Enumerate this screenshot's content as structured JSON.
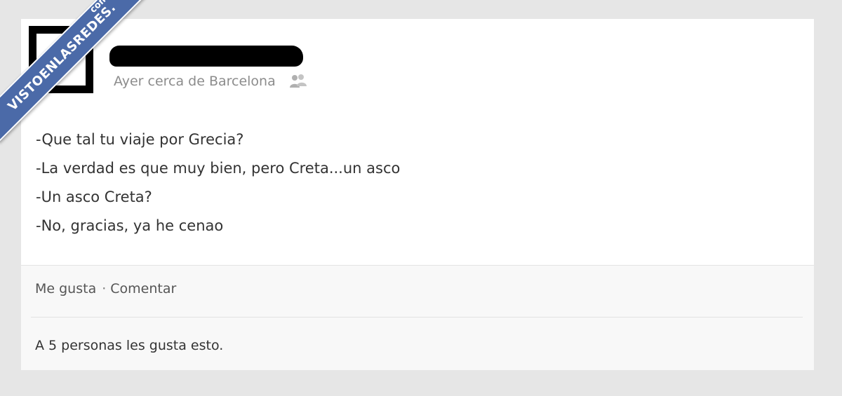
{
  "watermark": {
    "text": "VISTOENLASREDES.",
    "suffix": "com",
    "color": "#4b6aa8"
  },
  "post": {
    "meta": {
      "time_location": "Ayer cerca de Barcelona",
      "audience_icon": "people-icon"
    },
    "body_lines": [
      "-Que tal tu viaje por Grecia?",
      "-La verdad es que muy bien, pero Creta...un asco",
      "-Un asco Creta?",
      "-No, gracias, ya he cenao"
    ],
    "actions": {
      "like_label": "Me gusta",
      "separator": "·",
      "comment_label": "Comentar"
    },
    "likes_summary": "A 5 personas les gusta esto."
  },
  "colors": {
    "page_background": "#e6e6e6",
    "card_background": "#ffffff",
    "footer_background": "#f8f8f8",
    "meta_text": "#8c8c8c",
    "body_text": "#333333"
  }
}
